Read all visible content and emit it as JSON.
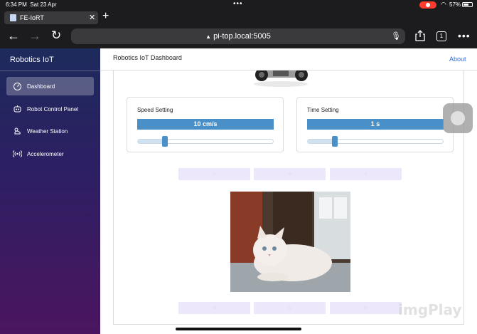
{
  "status": {
    "time": "6:34 PM",
    "date": "Sat 23 Apr",
    "battery": "57%"
  },
  "tab": {
    "title": "FE-IoRT"
  },
  "browser": {
    "url": "pi-top.local:5005",
    "tab_count": "1"
  },
  "sidebar": {
    "brand": "Robotics IoT",
    "items": [
      {
        "label": "Dashboard",
        "icon": "gauge-icon",
        "active": true
      },
      {
        "label": "Robot Control Panel",
        "icon": "robot-icon",
        "active": false
      },
      {
        "label": "Weather Station",
        "icon": "weather-icon",
        "active": false
      },
      {
        "label": "Accelerometer",
        "icon": "broadcast-icon",
        "active": false
      }
    ]
  },
  "header": {
    "title": "Robotics IoT Dashboard",
    "about": "About"
  },
  "speed": {
    "title": "Speed Setting",
    "value": "10 cm/s",
    "slider_fraction": 0.2
  },
  "time": {
    "title": "Time Setting",
    "value": "1 s",
    "slider_fraction": 0.2
  },
  "colors": {
    "accent": "#4a90c8",
    "button_bg": "#ede7fb",
    "sidebar_top": "#1d2a5c",
    "sidebar_bottom": "#4b1560"
  },
  "watermark": "imgPlay"
}
